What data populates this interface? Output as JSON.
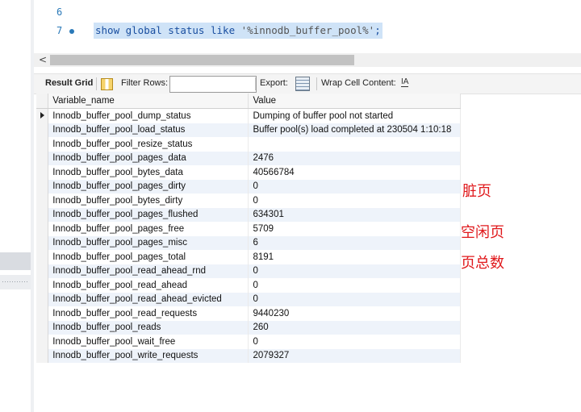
{
  "editor": {
    "lines": [
      {
        "number": "6",
        "code": ""
      },
      {
        "number": "7",
        "code_keyword": "show global status like ",
        "code_string": "'%innodb_buffer_pool%'",
        "code_end": ";"
      }
    ]
  },
  "scrollbar": {
    "left_arrow": "<"
  },
  "toolbar": {
    "result_grid": "Result Grid",
    "filter_rows": "Filter Rows:",
    "filter_value": "",
    "export": "Export:",
    "wrap_cell_content": "Wrap Cell Content:",
    "wrap_icon_glyph": "IA"
  },
  "grid": {
    "columns": [
      "Variable_name",
      "Value"
    ],
    "rows": [
      [
        "Innodb_buffer_pool_dump_status",
        "Dumping of buffer pool not started"
      ],
      [
        "Innodb_buffer_pool_load_status",
        "Buffer pool(s) load completed at 230504  1:10:18"
      ],
      [
        "Innodb_buffer_pool_resize_status",
        ""
      ],
      [
        "Innodb_buffer_pool_pages_data",
        "2476"
      ],
      [
        "Innodb_buffer_pool_bytes_data",
        "40566784"
      ],
      [
        "Innodb_buffer_pool_pages_dirty",
        "0"
      ],
      [
        "Innodb_buffer_pool_bytes_dirty",
        "0"
      ],
      [
        "Innodb_buffer_pool_pages_flushed",
        "634301"
      ],
      [
        "Innodb_buffer_pool_pages_free",
        "5709"
      ],
      [
        "Innodb_buffer_pool_pages_misc",
        "6"
      ],
      [
        "Innodb_buffer_pool_pages_total",
        "8191"
      ],
      [
        "Innodb_buffer_pool_read_ahead_rnd",
        "0"
      ],
      [
        "Innodb_buffer_pool_read_ahead",
        "0"
      ],
      [
        "Innodb_buffer_pool_read_ahead_evicted",
        "0"
      ],
      [
        "Innodb_buffer_pool_read_requests",
        "9440230"
      ],
      [
        "Innodb_buffer_pool_reads",
        "260"
      ],
      [
        "Innodb_buffer_pool_wait_free",
        "0"
      ],
      [
        "Innodb_buffer_pool_write_requests",
        "2079327"
      ]
    ]
  },
  "annotations": {
    "dirty": "脏页",
    "free": "空闲页",
    "total": "页总数"
  },
  "colors": {
    "selection": "#cfe3f7",
    "line_number": "#2a79b8",
    "annotation": "#e0181b"
  }
}
